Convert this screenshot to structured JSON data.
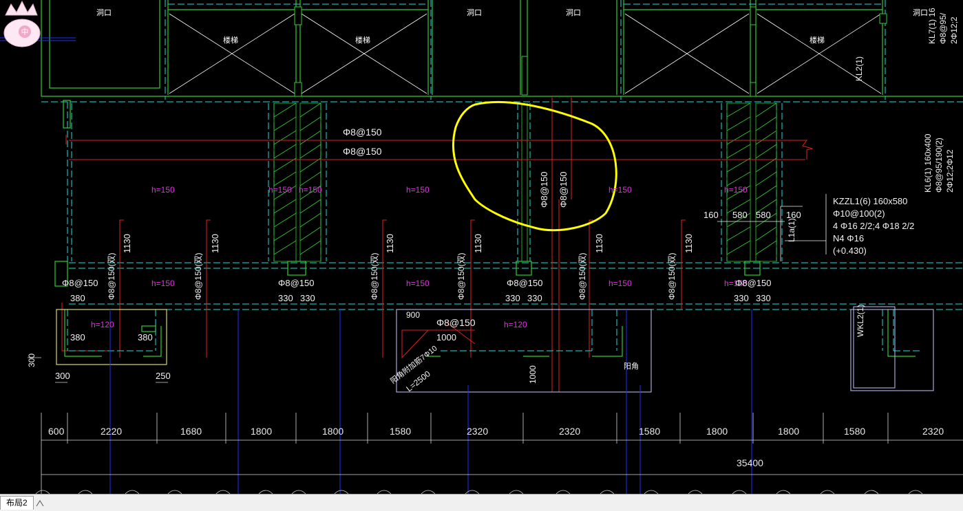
{
  "tabs": {
    "layout2": "布局2"
  },
  "rooms": {
    "room_a": "洞口",
    "room_b": "洞口",
    "room_c": "洞口",
    "room_d": "洞口",
    "stair_a": "楼梯",
    "stair_b": "楼梯",
    "stair_c": "楼梯"
  },
  "rebar": {
    "slab_top_1": "Φ8@150",
    "slab_top_2": "Φ8@150",
    "slab_v1": "Φ8@150",
    "slab_v2": "Φ8@150",
    "lower_1": "Φ8@150",
    "lower_2": "Φ8@150",
    "lower_3": "Φ8@150",
    "lower_4": "Φ8@150",
    "lower_5": "Φ8@150",
    "v_1": "Φ8@150(双)",
    "v_2": "Φ8@150(双)",
    "v_3": "Φ8@150(双)",
    "v_4": "Φ8@150(双)",
    "v_5": "Φ8@150(双)",
    "v_6": "Φ8@150(双)"
  },
  "thickness": {
    "h1": "h=150",
    "h2": "h=150",
    "h3": "h=150",
    "h4": "h=150",
    "h5": "h=150",
    "h6": "h=150",
    "h7": "h=150",
    "h8": "h=150",
    "h9": "h=150",
    "h10": "h=150",
    "h11": "h=120",
    "h12": "h=120"
  },
  "lengths": {
    "l1": "1130",
    "l2": "1130",
    "l3": "1130",
    "l4": "1130",
    "l5": "1130",
    "l6": "1130",
    "a380_1": "380",
    "a380_2": "380",
    "a380_3": "380",
    "a330_1": "330",
    "a330_2": "330",
    "a330_3": "330",
    "a330_4": "330",
    "a330_5": "330",
    "a330_6": "330",
    "d160a": "160",
    "d580a": "580",
    "d580b": "580",
    "d160b": "160",
    "d900": "900",
    "d1000a": "1000",
    "d1000b": "1000",
    "d300a": "300",
    "d300b": "300",
    "d250": "250"
  },
  "labels": {
    "kzzl_1": "KZZL1(6) 160x580",
    "kzzl_2": "Φ10@100(2)",
    "kzzl_3": "4 Φ16  2/2;4 Φ18  2/2",
    "kzzl_4": "N4 Φ16",
    "kzzl_5": "(+0.430)",
    "kl6_1": "KL6(1) 160x400",
    "kl6_2": "Φ8@95/190(2)",
    "kl6_3": "2Φ12;2Φ12",
    "kl7_1": "KL7(1) 16",
    "kl7_2": "Φ8@95/",
    "kl7_3": "2Φ12;2",
    "kl2": "KL2(1)",
    "l1a": "L1a(1)",
    "wkl2": "WKL2(1)",
    "corner": "阳角",
    "corner_bar": "阳角附加筋7Φ10",
    "corner_len": "L=2500"
  },
  "bottom_dims": [
    "600",
    "2220",
    "1680",
    "1800",
    "1800",
    "1580",
    "2320",
    "2320",
    "1580",
    "1800",
    "1800",
    "1580",
    "2320"
  ],
  "total_dim": "35400",
  "colors": {
    "green": "#33cc33",
    "cyan": "#22dddd",
    "red": "#e02020",
    "blue": "#2030ff",
    "yellow": "#ffff00",
    "magenta": "#e030e0",
    "white": "#f0f0f0"
  }
}
